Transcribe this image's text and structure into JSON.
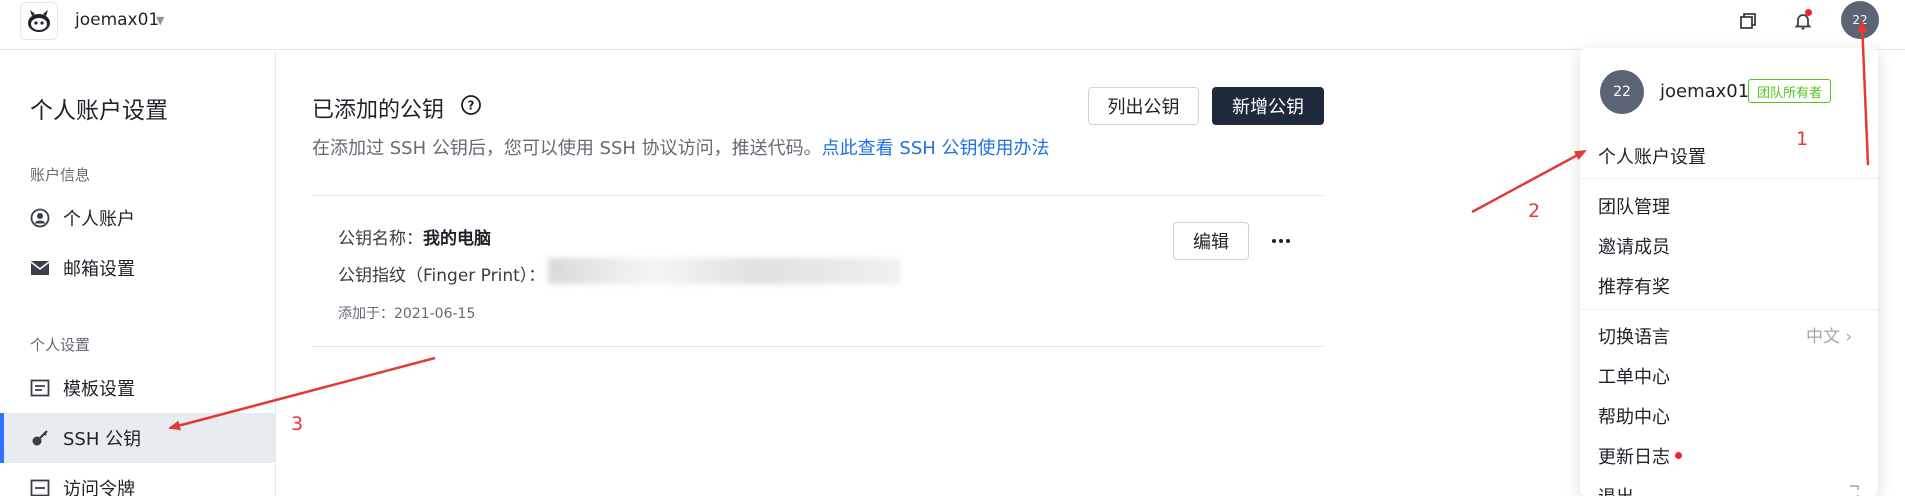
{
  "header": {
    "team_name": "joemax01",
    "avatar_text": "22",
    "icons": [
      "logo-icon",
      "chevron-down-icon",
      "window-icon",
      "bell-icon"
    ]
  },
  "sidebar": {
    "title": "个人账户设置",
    "groups": [
      {
        "label": "账户信息",
        "items": [
          {
            "label": "个人账户",
            "icon": "user-circle-icon"
          },
          {
            "label": "邮箱设置",
            "icon": "mail-icon"
          }
        ]
      },
      {
        "label": "个人设置",
        "items": [
          {
            "label": "模板设置",
            "icon": "template-icon"
          },
          {
            "label": "SSH 公钥",
            "icon": "key-icon",
            "active": true
          },
          {
            "label": "访问令牌",
            "icon": "token-icon"
          }
        ]
      }
    ]
  },
  "main": {
    "title": "已添加的公钥",
    "description": "在添加过 SSH 公钥后，您可以使用 SSH 协议访问，推送代码。",
    "link_text": "点此查看 SSH 公钥使用办法",
    "list_button": "列出公钥",
    "add_button": "新增公钥",
    "key": {
      "name_label": "公钥名称：",
      "name_value": "我的电脑",
      "fingerprint_label": "公钥指纹（Finger Print）：",
      "added_label": "添加于：",
      "added_date": "2021-06-15",
      "edit_button": "编辑"
    }
  },
  "dropdown": {
    "avatar_text": "22",
    "username": "joemax01",
    "role_badge": "团队所有者",
    "items": {
      "account_settings": "个人账户设置",
      "team_management": "团队管理",
      "invite_members": "邀请成员",
      "referral": "推荐有奖",
      "switch_language": "切换语言",
      "language_value": "中文",
      "ticket_center": "工单中心",
      "help_center": "帮助中心",
      "changelog": "更新日志",
      "logout": "退出"
    }
  },
  "annotations": {
    "n1": "1",
    "n2": "2",
    "n3": "3"
  },
  "colors": {
    "accent": "#3370ff",
    "link": "#1f6fe5",
    "primary_button": "#1f2a3c",
    "badge_green": "#52c41a",
    "annotation_red": "#e53935"
  }
}
